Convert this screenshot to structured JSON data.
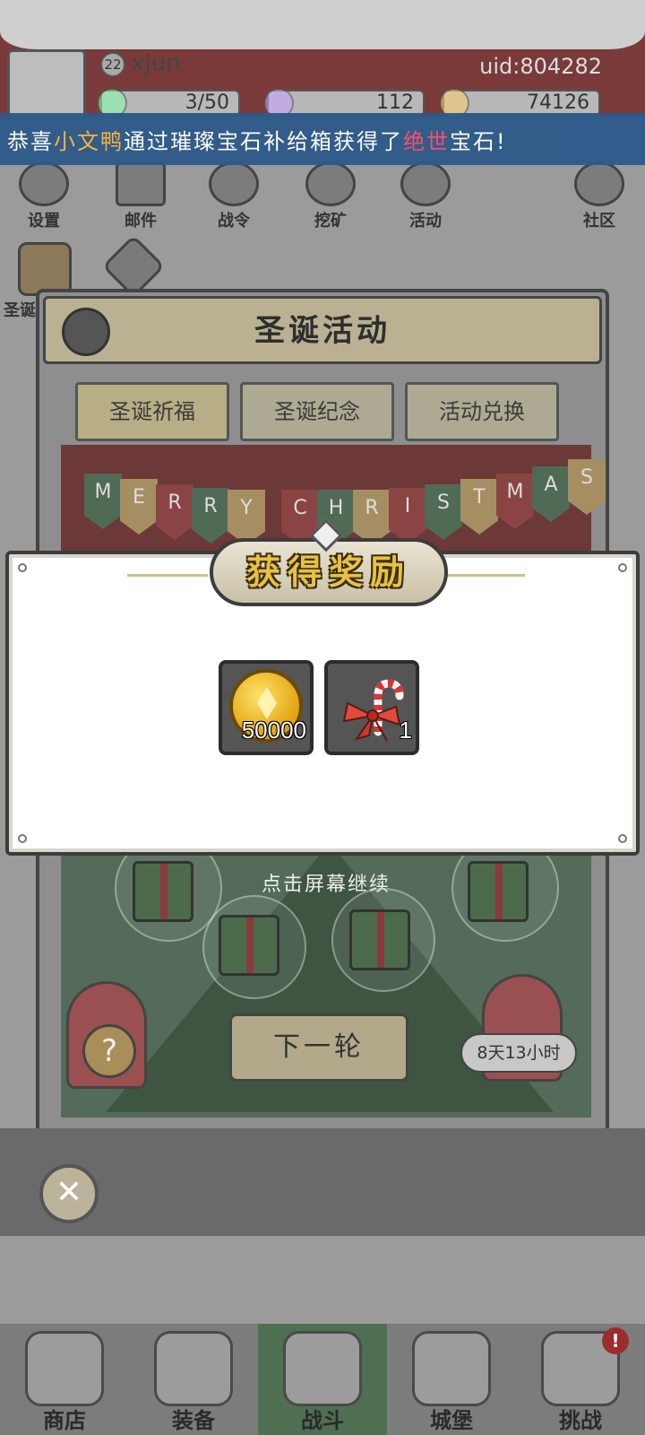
{
  "player": {
    "level": "22",
    "username": "xjun",
    "uid": "uid:804282",
    "energy": "3/50",
    "gems": "112",
    "coins": "74126"
  },
  "announcement": {
    "prefix": "恭喜",
    "player": "小文鸭",
    "middle": "通过璀璨宝石补给箱获得了",
    "rarity": "绝世",
    "suffix": "宝石!"
  },
  "top_menu": [
    {
      "label": "设置",
      "icon": "gear-icon"
    },
    {
      "label": "邮件",
      "icon": "mail-icon"
    },
    {
      "label": "战令",
      "icon": "battle-pass-icon"
    },
    {
      "label": "挖矿",
      "icon": "mining-icon"
    },
    {
      "label": "活动",
      "icon": "laurel-icon"
    },
    {
      "label": "社区",
      "icon": "home-icon"
    }
  ],
  "side": {
    "christmas_label": "圣诞"
  },
  "panel": {
    "title": "圣诞活动",
    "tabs": [
      "圣诞祈福",
      "圣诞纪念",
      "活动兑换"
    ],
    "banner_letters": [
      "M",
      "E",
      "R",
      "R",
      "Y",
      "C",
      "H",
      "R",
      "I",
      "S",
      "T",
      "M",
      "A",
      "S"
    ],
    "tap_hint": "点击屏幕继续",
    "next_round": "下一轮",
    "timer": "8天13小时",
    "question": "?"
  },
  "reward": {
    "title": "获得奖励",
    "items": [
      {
        "name": "coin",
        "icon": "gold-coin-icon",
        "count": "50000"
      },
      {
        "name": "candy-bow",
        "icon": "candy-cane-bow-icon",
        "count": "1"
      }
    ]
  },
  "close": {
    "symbol": "✕"
  },
  "bottom_nav": [
    {
      "label": "商店",
      "icon": "shop-icon"
    },
    {
      "label": "装备",
      "icon": "backpack-icon"
    },
    {
      "label": "战斗",
      "icon": "crossed-swords-icon",
      "active": true
    },
    {
      "label": "城堡",
      "icon": "castle-icon"
    },
    {
      "label": "挑战",
      "icon": "challenge-shield-icon",
      "badge": "!"
    }
  ],
  "colors": {
    "announce_bg": "#2e5a8a",
    "highlight_player": "#ffb637",
    "highlight_rarity": "#ff4d62",
    "reward_title": "#e8c042"
  }
}
